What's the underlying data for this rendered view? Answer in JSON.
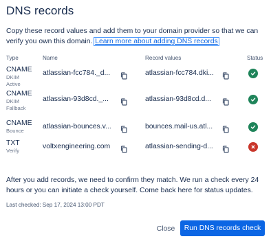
{
  "title": "DNS records",
  "intro": {
    "text": "Copy these record values and add them to your domain provider so that we can verify you own this domain. ",
    "link": "Learn more about adding DNS records"
  },
  "table": {
    "headers": {
      "type": "Type",
      "name": "Name",
      "value": "Record values",
      "status": "Status"
    },
    "rows": [
      {
        "type": "CNAME",
        "sub": "DKIM Active",
        "name": "atlassian-fcc784._d...",
        "value": "atlassian-fcc784.dki...",
        "status": "verified"
      },
      {
        "type": "CNAME",
        "sub": "DKIM Fallback",
        "name": "atlassian-93d8cd._...",
        "value": "atlassian-93d8cd.d...",
        "status": "verified"
      },
      {
        "type": "CNAME",
        "sub": "Bounce",
        "name": "atlassian-bounces.v...",
        "value": "bounces.mail-us.atl...",
        "status": "verified"
      },
      {
        "type": "TXT",
        "sub": "Verify",
        "name": "voltxengineering.com",
        "value": "atlassian-sending-d...",
        "status": "failed"
      }
    ]
  },
  "footer_text": "After you add records, we need to confirm they match. We run a check every 24 hours or you can initiate a check yourself. Come back here for status updates.",
  "last_checked": "Last checked: Sep 17, 2024 13:00 PDT",
  "buttons": {
    "close": "Close",
    "run": "Run DNS records check"
  },
  "colors": {
    "primary": "#0c66e4",
    "success": "#1f845a",
    "danger": "#c9372c",
    "text": "#172b4d"
  }
}
